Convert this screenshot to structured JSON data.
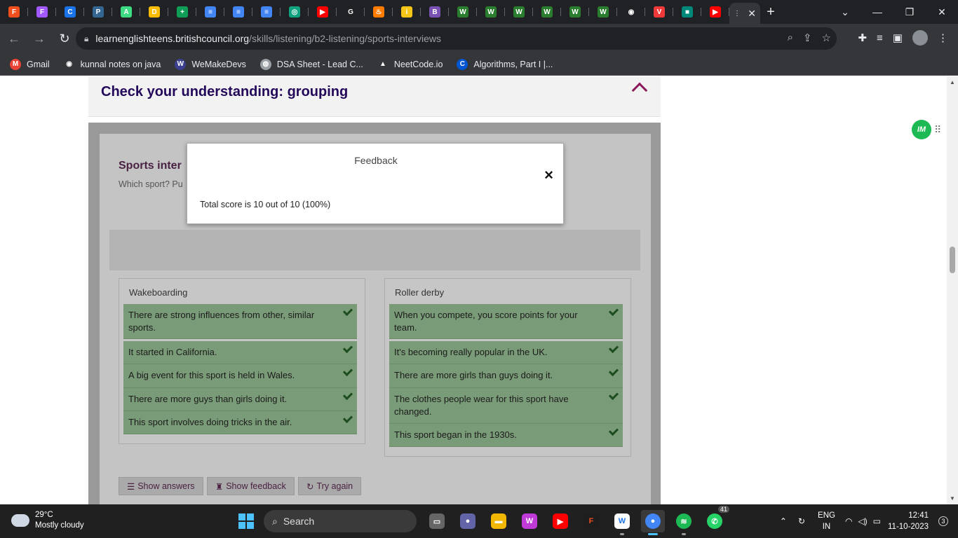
{
  "browser": {
    "tabs": [
      {
        "icon": "figma-icon",
        "color": "#f24e1e",
        "letter": "F"
      },
      {
        "icon": "figma-icon",
        "color": "#a259ff",
        "letter": "F"
      },
      {
        "icon": "chrome-icon",
        "color": "#1a73e8",
        "letter": "C"
      },
      {
        "icon": "postgres-icon",
        "color": "#336791",
        "letter": "P"
      },
      {
        "icon": "android-icon",
        "color": "#3ddc84",
        "letter": "A"
      },
      {
        "icon": "drive-icon",
        "color": "#fbbc04",
        "letter": "D"
      },
      {
        "icon": "sheets-icon",
        "color": "#0f9d58",
        "letter": "+"
      },
      {
        "icon": "docs-icon",
        "color": "#4285f4",
        "letter": "≡"
      },
      {
        "icon": "docs-icon",
        "color": "#4285f4",
        "letter": "≡"
      },
      {
        "icon": "docs-icon",
        "color": "#4285f4",
        "letter": "≡"
      },
      {
        "icon": "openai-icon",
        "color": "#10a37f",
        "letter": "◎"
      },
      {
        "icon": "youtube-icon",
        "color": "#ff0000",
        "letter": "▶"
      },
      {
        "icon": "google-icon",
        "color": "#ffffff",
        "letter": "G"
      },
      {
        "icon": "fire-icon",
        "color": "#ff7a00",
        "letter": "♨"
      },
      {
        "icon": "imdb-icon",
        "color": "#f5c518",
        "letter": "i"
      },
      {
        "icon": "bootstrap-icon",
        "color": "#7952b3",
        "letter": "B"
      },
      {
        "icon": "w-icon",
        "color": "#2a7d2e",
        "letter": "W"
      },
      {
        "icon": "w-icon",
        "color": "#2a7d2e",
        "letter": "W"
      },
      {
        "icon": "w-icon",
        "color": "#2a7d2e",
        "letter": "W"
      },
      {
        "icon": "w-icon",
        "color": "#2a7d2e",
        "letter": "W"
      },
      {
        "icon": "w-icon",
        "color": "#2a7d2e",
        "letter": "W"
      },
      {
        "icon": "w-icon",
        "color": "#2a7d2e",
        "letter": "W"
      },
      {
        "icon": "github-icon",
        "color": "#ffffff",
        "letter": "◉"
      },
      {
        "icon": "vivaldi-icon",
        "color": "#ef3939",
        "letter": "V"
      },
      {
        "icon": "meet-icon",
        "color": "#00897b",
        "letter": "■"
      },
      {
        "icon": "youtube-icon",
        "color": "#ff0000",
        "letter": "▶"
      }
    ],
    "url_host": "learnenglishteens.britishcouncil.org",
    "url_path": "/skills/listening/b2-listening/sports-interviews",
    "bookmarks": [
      {
        "label": "Gmail",
        "icon": "gmail-icon",
        "color": "#ea4335",
        "letter": "M"
      },
      {
        "label": "kunnal notes on java",
        "icon": "github-icon",
        "color": "#ffffff",
        "letter": "◉"
      },
      {
        "label": "WeMakeDevs",
        "icon": "wemakedevs-icon",
        "color": "#3b3f8f",
        "letter": "W"
      },
      {
        "label": "DSA Sheet - Lead C...",
        "icon": "globe-icon",
        "color": "#9aa0a6",
        "letter": "◍"
      },
      {
        "label": "NeetCode.io",
        "icon": "rocket-icon",
        "color": "#35363a",
        "letter": "▲"
      },
      {
        "label": "Algorithms, Part I |...",
        "icon": "coursera-icon",
        "color": "#0056d2",
        "letter": "C"
      }
    ]
  },
  "page": {
    "section_title": "Check your understanding: grouping",
    "exercise_title": "Sports inter",
    "exercise_instruction": "Which sport? Pu",
    "groups": [
      {
        "title": "Wakeboarding",
        "items": [
          "There are strong influences from other, similar sports.",
          "It started in California.",
          "A big event for this sport is held in Wales.",
          "There are more guys than girls doing it.",
          "This sport involves doing tricks in the air."
        ]
      },
      {
        "title": "Roller derby",
        "items": [
          "When you compete, you score points for your team.",
          "It's becoming really popular in the UK.",
          "There are more girls than guys doing it.",
          "The clothes people wear for this sport have changed.",
          "This sport began in the 1930s."
        ]
      }
    ],
    "buttons": {
      "show_answers": "Show answers",
      "show_feedback": "Show feedback",
      "try_again": "Try again"
    },
    "modal": {
      "title": "Feedback",
      "close": "×",
      "body": "Total score is 10 out of 10 (100%)"
    },
    "extension_badge": "IM"
  },
  "taskbar": {
    "weather_temp": "29°C",
    "weather_desc": "Mostly cloudy",
    "search_label": "Search",
    "lang_top": "ENG",
    "lang_bottom": "IN",
    "time": "12:41",
    "date": "11-10-2023",
    "notifications": "3",
    "whatsapp_badge": "41"
  },
  "colors": {
    "accent_purple": "#23085a",
    "item_green": "#7a9b78",
    "chevron": "#8a1a5c"
  }
}
